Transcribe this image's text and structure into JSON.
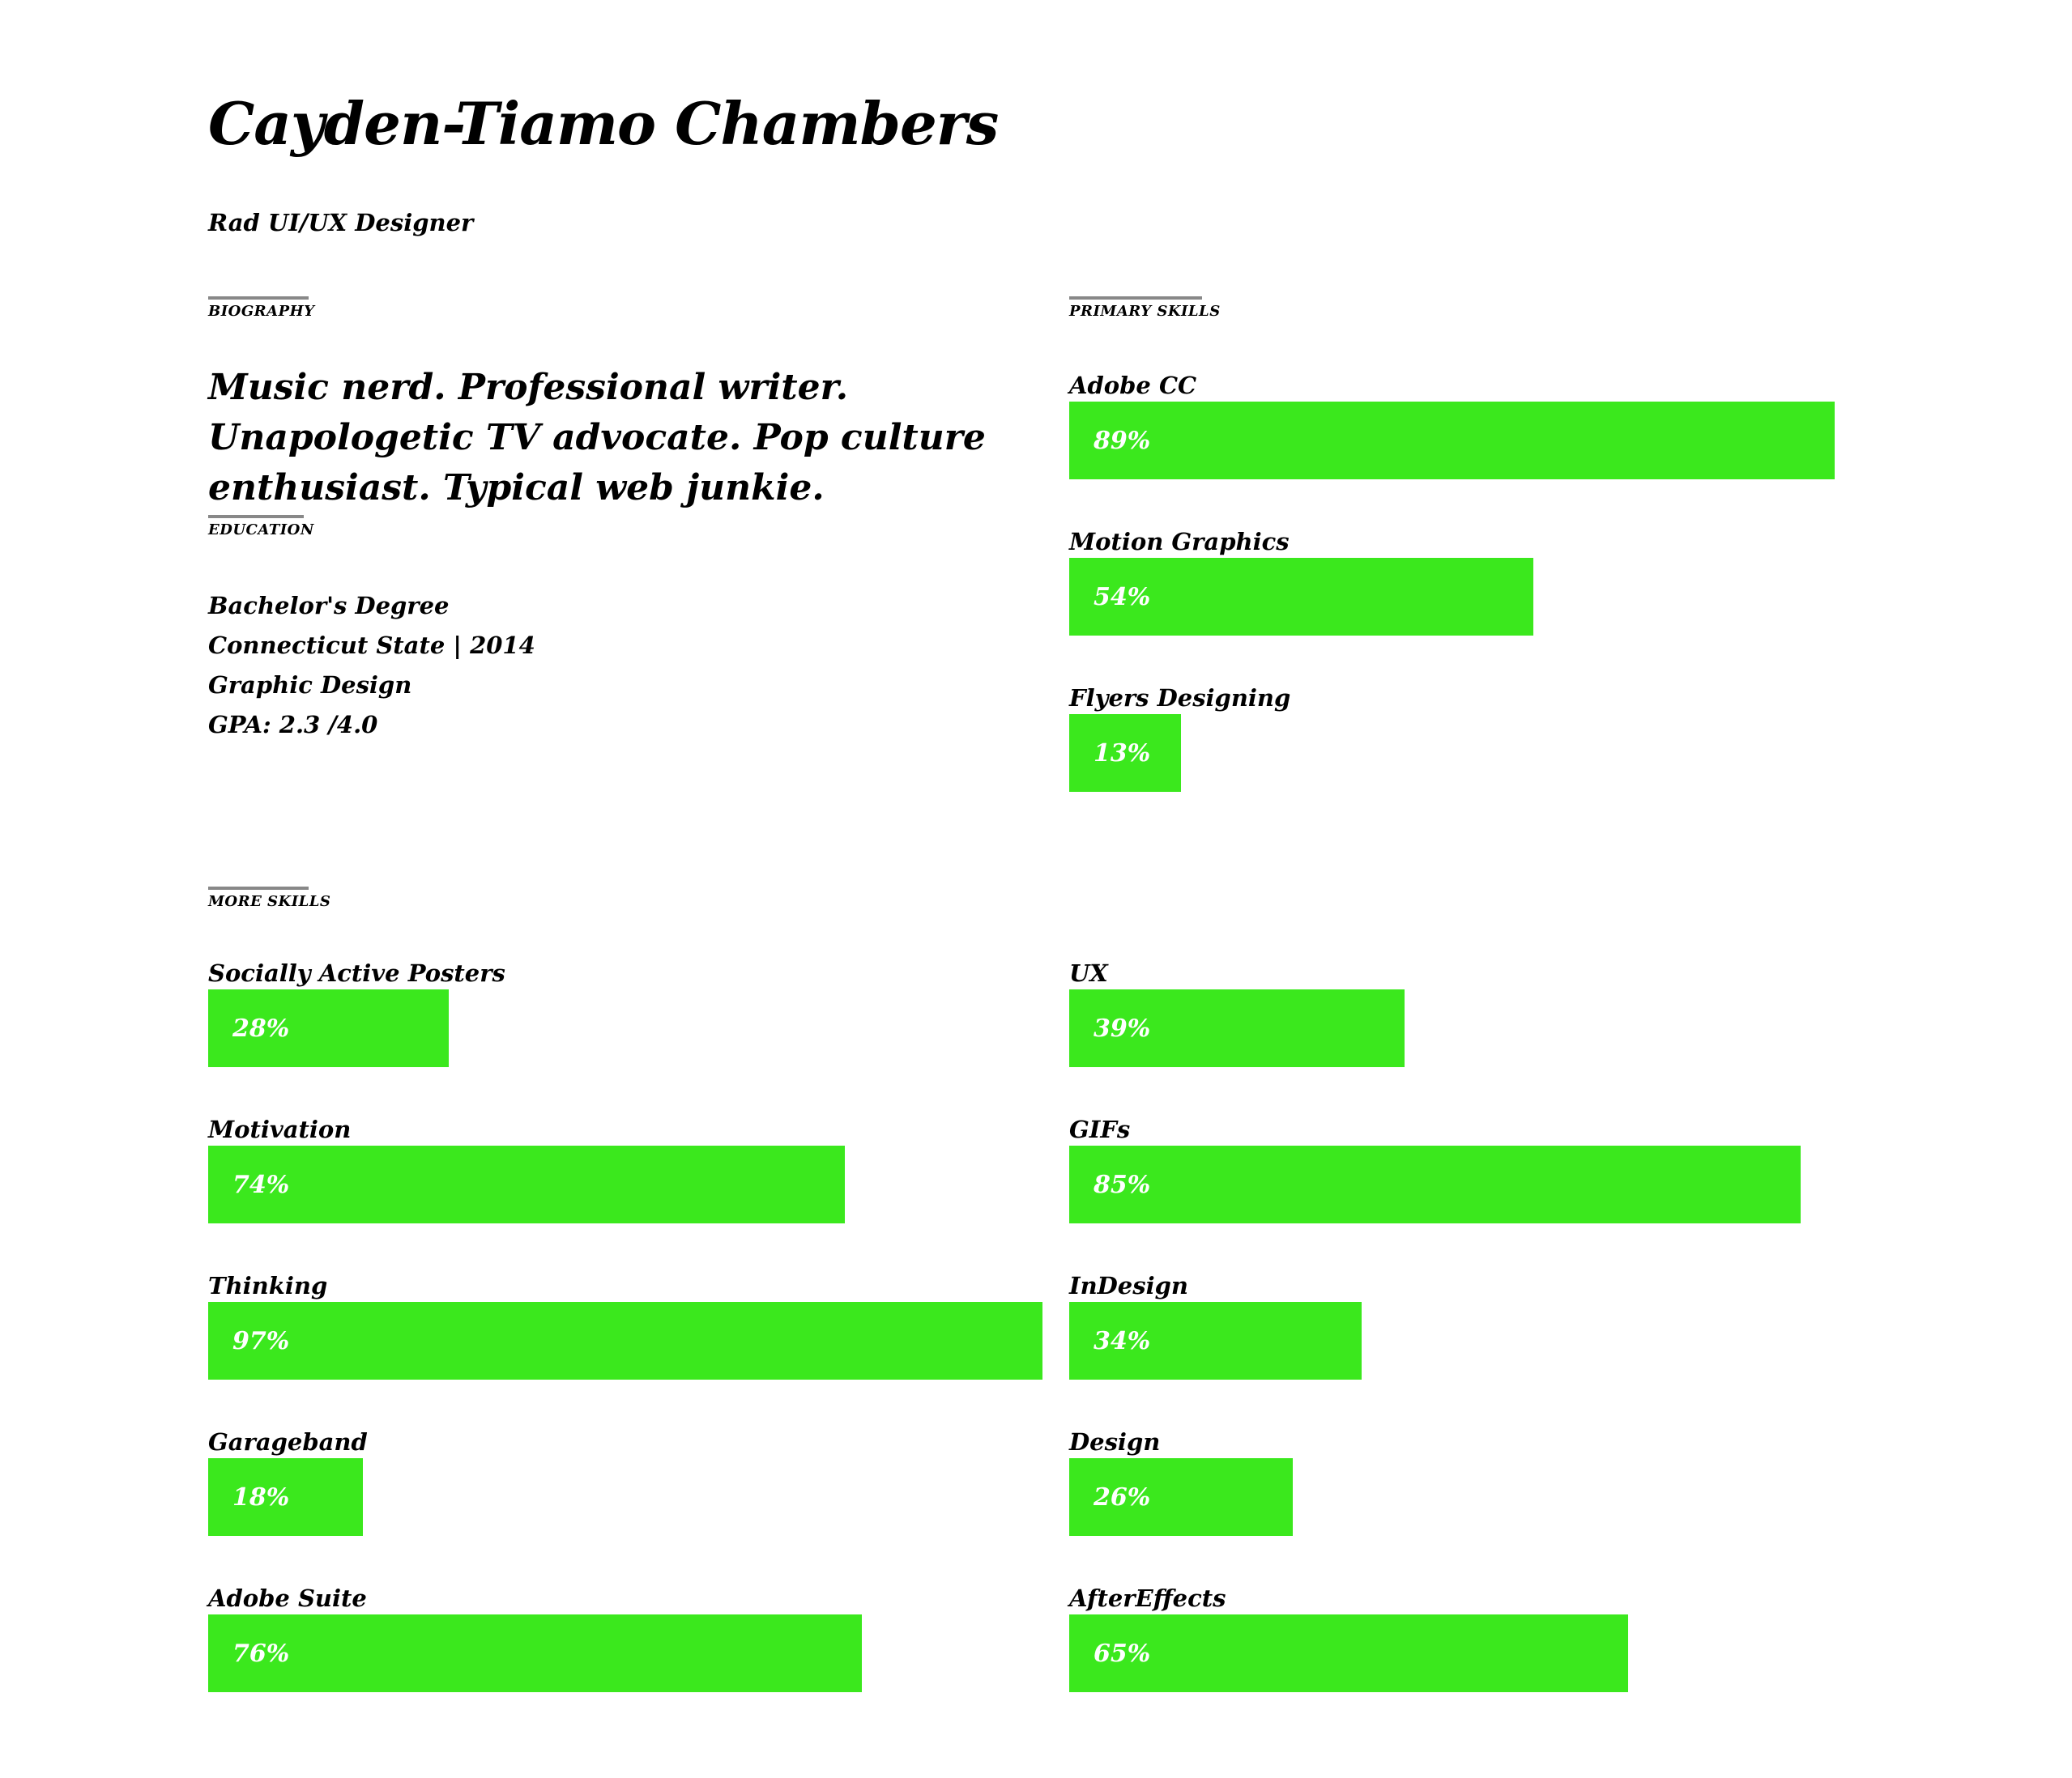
{
  "profile": {
    "name": "Cayden-Tiamo Chambers",
    "role": "Rad UI/UX Designer"
  },
  "biography": {
    "heading": "BIOGRAPHY",
    "text": "Music nerd. Professional writer. Unapologetic TV advocate. Pop culture enthusiast. Typical web junkie."
  },
  "education": {
    "heading": "EDUCATION",
    "degree": "Bachelor's Degree",
    "school": "Connecticut State | 2014",
    "major": "Graphic Design",
    "gpa": "GPA: 2.3 /4.0"
  },
  "primary_skills": {
    "heading": "PRIMARY SKILLS",
    "items": [
      {
        "label": "Adobe CC",
        "value": 89,
        "display": "89%"
      },
      {
        "label": "Motion Graphics",
        "value": 54,
        "display": "54%"
      },
      {
        "label": "Flyers Designing",
        "value": 13,
        "display": "13%"
      }
    ]
  },
  "more_skills": {
    "heading": "MORE SKILLS",
    "left": [
      {
        "label": "Socially Active Posters",
        "value": 28,
        "display": "28%"
      },
      {
        "label": "Motivation",
        "value": 74,
        "display": "74%"
      },
      {
        "label": "Thinking",
        "value": 97,
        "display": "97%"
      },
      {
        "label": "Garageband",
        "value": 18,
        "display": "18%"
      },
      {
        "label": "Adobe Suite",
        "value": 76,
        "display": "76%"
      }
    ],
    "right": [
      {
        "label": "UX",
        "value": 39,
        "display": "39%"
      },
      {
        "label": "GIFs",
        "value": 85,
        "display": "85%"
      },
      {
        "label": "InDesign",
        "value": 34,
        "display": "34%"
      },
      {
        "label": "Design",
        "value": 26,
        "display": "26%"
      },
      {
        "label": "AfterEffects",
        "value": 65,
        "display": "65%"
      }
    ]
  },
  "colors": {
    "bar": "#3be81d",
    "rule": "#888888",
    "text": "#000000",
    "bar_text": "#ffffff"
  }
}
